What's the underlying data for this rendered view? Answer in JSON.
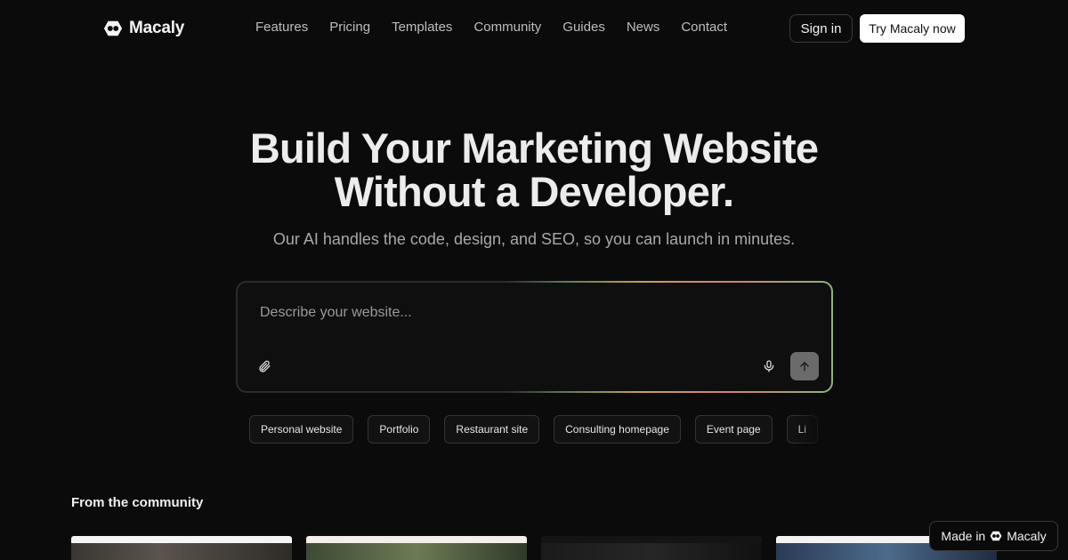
{
  "brand": {
    "name": "Macaly"
  },
  "nav": {
    "links": [
      "Features",
      "Pricing",
      "Templates",
      "Community",
      "Guides",
      "News",
      "Contact"
    ],
    "sign_in": "Sign in",
    "cta": "Try Macaly now"
  },
  "hero": {
    "title_line1": "Build Your Marketing Website",
    "title_line2": "Without a Developer.",
    "subtitle": "Our AI handles the code, design, and SEO, so you can launch in minutes."
  },
  "prompt": {
    "placeholder": "Describe your website...",
    "value": "",
    "icons": {
      "attach": "paperclip-icon",
      "mic": "microphone-icon",
      "send": "arrow-up-icon"
    }
  },
  "suggestions": [
    "Personal website",
    "Portfolio",
    "Restaurant site",
    "Consulting homepage",
    "Event page",
    "Li"
  ],
  "community": {
    "title": "From the community"
  },
  "badge": {
    "prefix": "Made in",
    "brand": "Macaly"
  },
  "colors": {
    "background": "#0b0b0b",
    "cta_bg": "#ffffff",
    "send_bg": "#6b6b6b",
    "accent_gradient": [
      "#5a7a5a",
      "#c9a24a",
      "#d07f7f",
      "#8fb27c"
    ]
  }
}
